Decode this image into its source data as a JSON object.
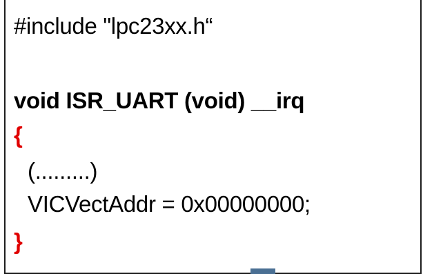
{
  "code": {
    "include_line": "#include \"lpc23xx.h“",
    "function_signature": "void ISR_UART (void) __irq",
    "open_brace": "{",
    "body_line_1": "(.........)",
    "body_line_2": "VICVectAddr = 0x00000000;",
    "close_brace": "}"
  },
  "colors": {
    "brace": "#e00000",
    "text": "#000000",
    "border": "#1c1c1c",
    "bottom_marker": "#4a6f93"
  }
}
